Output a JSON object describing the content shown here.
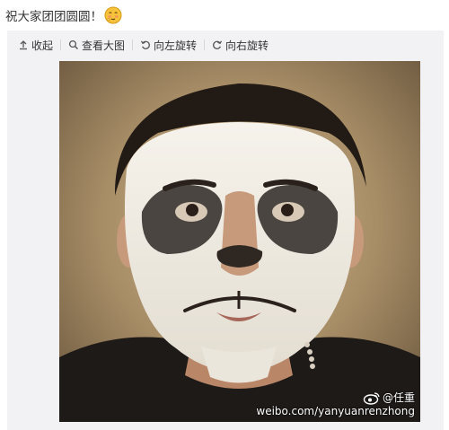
{
  "post": {
    "text": "祝大家团团圆圆！",
    "emoji_icon": "shy-face-emoji-icon"
  },
  "toolbar": {
    "items": [
      {
        "label": "收起",
        "icon": "arrow-up-collapse-icon"
      },
      {
        "label": "查看大图",
        "icon": "magnifier-icon"
      },
      {
        "label": "向左旋转",
        "icon": "rotate-left-icon"
      },
      {
        "label": "向右旋转",
        "icon": "rotate-right-icon"
      }
    ]
  },
  "photo": {
    "watermark_handle": "@任重",
    "watermark_url": "weibo.com/yanyuanrenzhong",
    "watermark_icon": "weibo-logo-icon"
  },
  "colors": {
    "panel_bg": "#f2f2f5",
    "text": "#333333",
    "separator": "#d6d6d6"
  }
}
